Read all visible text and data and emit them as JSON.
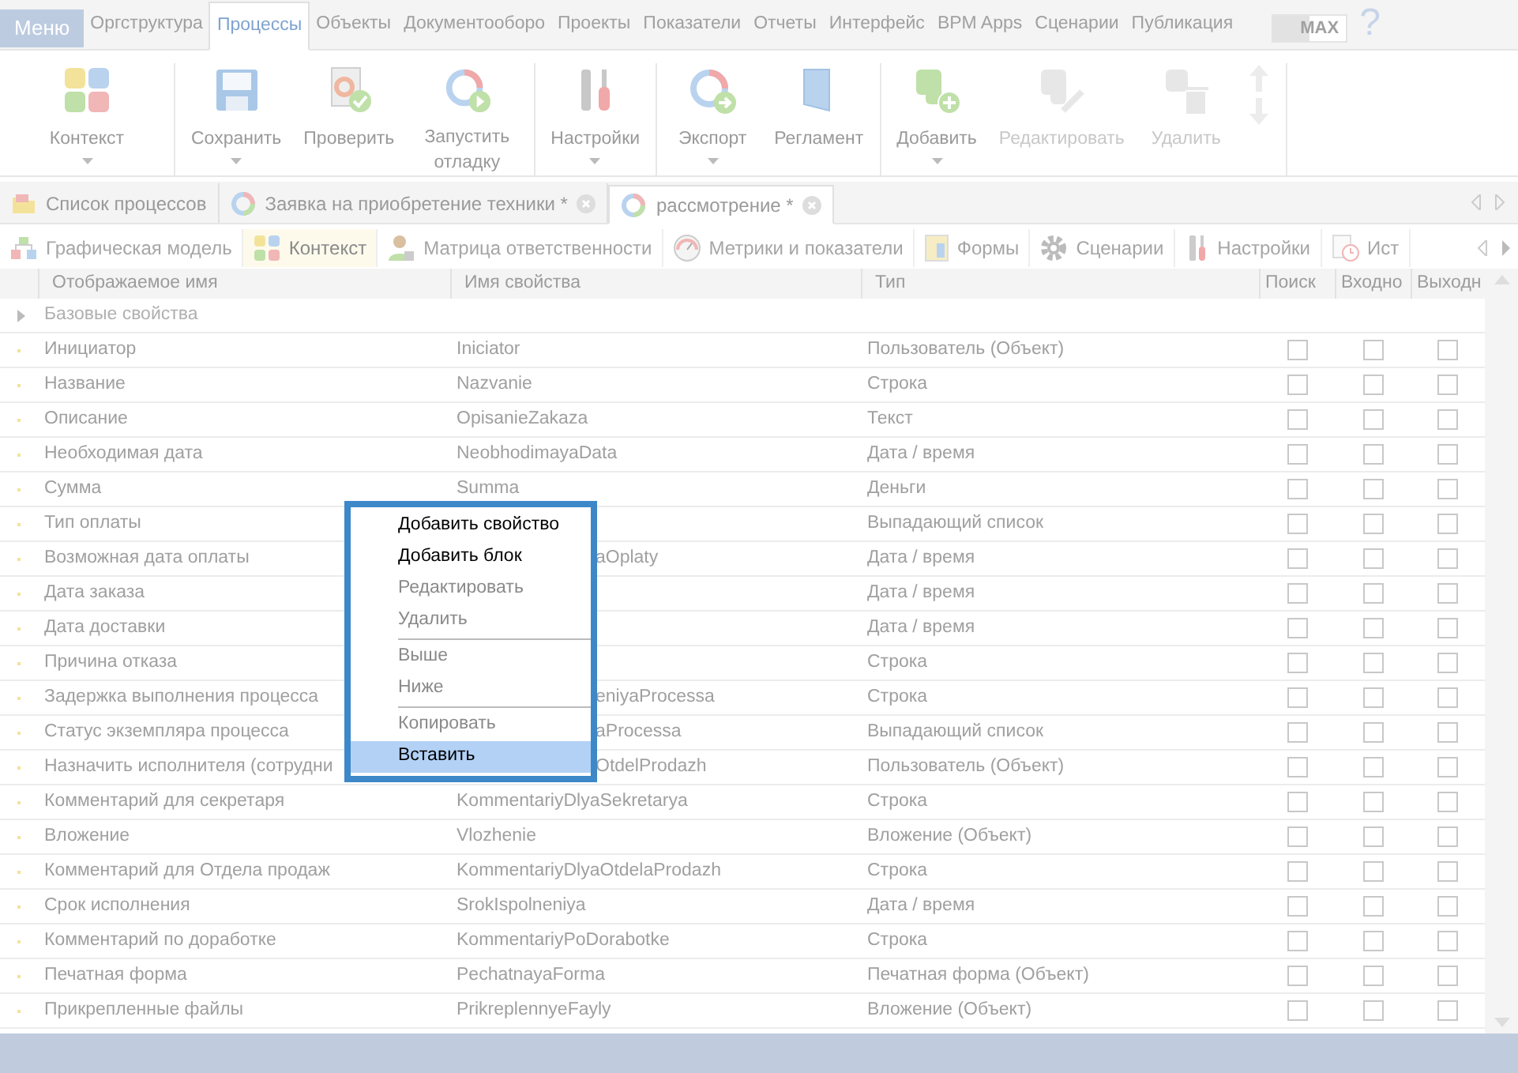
{
  "top_tabs": {
    "menu": "Меню",
    "items": [
      {
        "label": "Оргструктура",
        "selected": false
      },
      {
        "label": "Процессы",
        "selected": true
      },
      {
        "label": "Объекты",
        "selected": false
      },
      {
        "label": "Документооборо",
        "selected": false
      },
      {
        "label": "Проекты",
        "selected": false
      },
      {
        "label": "Показатели",
        "selected": false
      },
      {
        "label": "Отчеты",
        "selected": false
      },
      {
        "label": "Интерфейс",
        "selected": false
      },
      {
        "label": "BPM Apps",
        "selected": false
      },
      {
        "label": "Сценарии",
        "selected": false
      },
      {
        "label": "Публикация",
        "selected": false
      }
    ],
    "mode": "MAX",
    "help": "?"
  },
  "ribbon": [
    [
      {
        "kind": "puzzle",
        "label": "Контекст",
        "dropdown": true,
        "disabled": false
      }
    ],
    [
      {
        "kind": "save",
        "label": "Сохранить",
        "dropdown": true,
        "disabled": false
      },
      {
        "kind": "check",
        "label": "Проверить",
        "dropdown": false,
        "disabled": false
      },
      {
        "kind": "debug",
        "label": "Запустить отладку",
        "dropdown": false,
        "disabled": false
      }
    ],
    [
      {
        "kind": "tools",
        "label": "Настройки",
        "dropdown": true,
        "disabled": false
      }
    ],
    [
      {
        "kind": "export",
        "label": "Экспорт",
        "dropdown": true,
        "disabled": false
      },
      {
        "kind": "doc",
        "label": "Регламент",
        "dropdown": false,
        "disabled": false
      }
    ],
    [
      {
        "kind": "add",
        "label": "Добавить",
        "dropdown": true,
        "disabled": false
      },
      {
        "kind": "edit",
        "label": "Редактировать",
        "dropdown": false,
        "disabled": true
      },
      {
        "kind": "delete",
        "label": "Удалить",
        "dropdown": false,
        "disabled": true
      },
      {
        "kind": "updown",
        "disabled": true
      }
    ]
  ],
  "doc_tabs": [
    {
      "label": "Список процессов",
      "kind": "list",
      "closable": false,
      "selected": false
    },
    {
      "label": "Заявка на приобретение техники *",
      "kind": "process",
      "closable": true,
      "selected": false
    },
    {
      "label": "рассмотрение *",
      "kind": "process",
      "closable": true,
      "selected": true
    }
  ],
  "sub_tabs": [
    {
      "label": "Графическая модель",
      "kind": "model",
      "selected": false
    },
    {
      "label": "Контекст",
      "kind": "puzzle",
      "selected": true
    },
    {
      "label": "Матрица ответственности",
      "kind": "matrix",
      "selected": false
    },
    {
      "label": "Метрики и показатели",
      "kind": "gauge",
      "selected": false
    },
    {
      "label": "Формы",
      "kind": "forms",
      "selected": false
    },
    {
      "label": "Сценарии",
      "kind": "gear",
      "selected": false
    },
    {
      "label": "Настройки",
      "kind": "tools",
      "selected": false
    },
    {
      "label": "Ист",
      "kind": "history",
      "selected": false
    }
  ],
  "table": {
    "columns": [
      "Отображаемое имя",
      "Имя свойства",
      "Тип",
      "Поиск",
      "Входно",
      "Выходн"
    ],
    "group": {
      "label": "Базовые свойства",
      "expanded": false
    },
    "rows": [
      {
        "name": "Инициатор",
        "property": "Iniciator",
        "type": "Пользователь (Объект)",
        "search": false,
        "input": false,
        "output": false
      },
      {
        "name": "Название",
        "property": "Nazvanie",
        "type": "Строка",
        "search": false,
        "input": false,
        "output": false
      },
      {
        "name": "Описание",
        "property": "OpisanieZakaza",
        "type": "Текст",
        "search": false,
        "input": false,
        "output": false
      },
      {
        "name": "Необходимая дата",
        "property": "NeobhodimayaData",
        "type": "Дата / время",
        "search": false,
        "input": false,
        "output": false
      },
      {
        "name": "Сумма",
        "property": "Summa",
        "type": "Деньги",
        "search": false,
        "input": false,
        "output": false
      },
      {
        "name": "Тип оплаты",
        "type": "Выпадающий список",
        "search": false,
        "input": false,
        "output": false
      },
      {
        "name": "Возможная дата оплаты",
        "property": "aOplaty",
        "property_clipped": true,
        "type": "Дата / время",
        "search": false,
        "input": false,
        "output": false
      },
      {
        "name": "Дата заказа",
        "type": "Дата / время",
        "search": false,
        "input": false,
        "output": false
      },
      {
        "name": "Дата доставки",
        "type": "Дата / время",
        "search": false,
        "input": false,
        "output": false
      },
      {
        "name": "Причина отказа",
        "type": "Строка",
        "search": false,
        "input": false,
        "output": false
      },
      {
        "name": "Задержка выполнения процесса",
        "property": "eniyaProcessa",
        "property_clipped": true,
        "type": "Строка",
        "search": false,
        "input": false,
        "output": false
      },
      {
        "name": "Статус экземпляра процесса",
        "property": "aProcessa",
        "property_clipped": true,
        "type": "Выпадающий список",
        "search": false,
        "input": false,
        "output": false
      },
      {
        "name": "Назначить исполнителя (сотрудни",
        "property": "OtdelProdazh",
        "property_clipped": true,
        "type": "Пользователь (Объект)",
        "search": false,
        "input": false,
        "output": false
      },
      {
        "name": "Комментарий для секретаря",
        "property": "KommentariyDlyaSekretarya",
        "type": "Строка",
        "search": false,
        "input": false,
        "output": false
      },
      {
        "name": "Вложение",
        "property": "Vlozhenie",
        "type": "Вложение (Объект)",
        "search": false,
        "input": false,
        "output": false
      },
      {
        "name": "Комментарий для Отдела продаж",
        "property": "KommentariyDlyaOtdelaProdazh",
        "type": "Строка",
        "search": false,
        "input": false,
        "output": false
      },
      {
        "name": "Срок исполнения",
        "property": "SrokIspolneniya",
        "type": "Дата / время",
        "search": false,
        "input": false,
        "output": false
      },
      {
        "name": "Комментарий по доработке",
        "property": "KommentariyPoDorabotke",
        "type": "Строка",
        "search": false,
        "input": false,
        "output": false
      },
      {
        "name": "Печатная форма",
        "property": "PechatnayaForma",
        "type": "Печатная форма (Объект)",
        "search": false,
        "input": false,
        "output": false
      },
      {
        "name": "Прикрепленные файлы",
        "property": "PrikreplennyeFayly",
        "type": "Вложение (Объект)",
        "search": false,
        "input": false,
        "output": false
      }
    ]
  },
  "context_menu": [
    {
      "kind": "item",
      "label": "Добавить свойство",
      "disabled": false,
      "selected": false
    },
    {
      "kind": "item",
      "label": "Добавить блок",
      "disabled": false,
      "selected": false
    },
    {
      "kind": "item",
      "label": "Редактировать",
      "disabled": true,
      "selected": false
    },
    {
      "kind": "item",
      "label": "Удалить",
      "disabled": true,
      "selected": false
    },
    {
      "kind": "separator"
    },
    {
      "kind": "item",
      "label": "Выше",
      "disabled": true,
      "selected": false
    },
    {
      "kind": "item",
      "label": "Ниже",
      "disabled": true,
      "selected": false
    },
    {
      "kind": "separator"
    },
    {
      "kind": "item",
      "label": "Копировать",
      "disabled": true,
      "selected": false
    },
    {
      "kind": "item",
      "label": "Вставить",
      "disabled": false,
      "selected": true
    }
  ]
}
